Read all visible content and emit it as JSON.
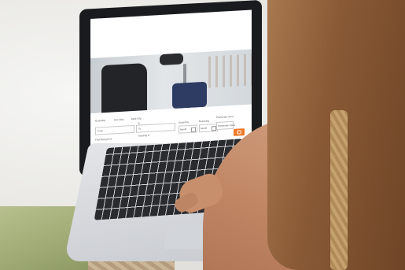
{
  "colors": {
    "accent_button": "#f07a2b",
    "suitcase": "#2e3c63",
    "laptop_bezel": "#1a1b1e"
  },
  "booking_form": {
    "trip_options": [
      "Roundtrip",
      "One-Way",
      "Multi-City"
    ],
    "from_label": "From",
    "to_label": "To",
    "from_placeholder": "From",
    "to_placeholder": "To",
    "first_flying_option": "First Flying Item",
    "travelling_with": "Traveling w",
    "departing_label": "Departing",
    "returning_label": "Returning",
    "departing_placeholder": "Month",
    "returning_placeholder": "Month",
    "passenger_label": "Passenger class",
    "passenger_value": "Passenger class",
    "search_icon": "search-icon"
  }
}
